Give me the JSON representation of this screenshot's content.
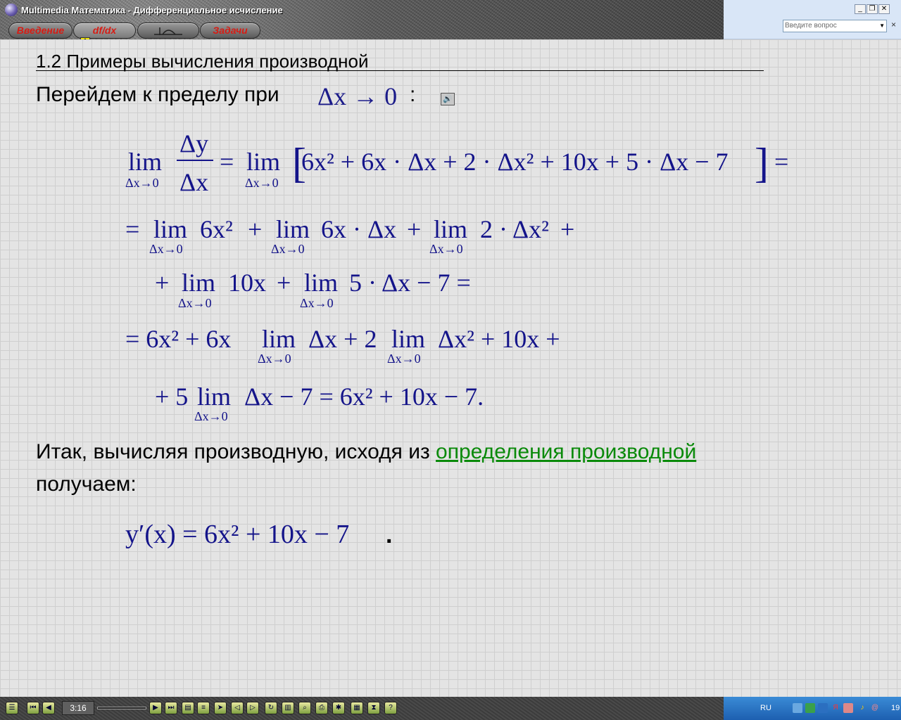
{
  "window": {
    "title": "Multimedia Математика - Дифференциальное исчисление",
    "nav": {
      "intro": "Введение",
      "deriv": "df/dx",
      "deriv_badge": "1",
      "tasks": "Задачи"
    },
    "help_placeholder": "Введите вопрос",
    "controls": {
      "minimize": "_",
      "restore": "❐",
      "close": "✕"
    },
    "help_close": "×"
  },
  "content": {
    "section_title": "1.2 Примеры вычисления производной",
    "intro_text": "Перейдем к пределу при",
    "intro_math": "Δx → 0",
    "intro_colon": ":",
    "conclusion_text_a": "Итак, вычисляя производную, исходя из",
    "conclusion_link": "определения производной",
    "conclusion_text_b": "получаем:",
    "formulas": {
      "lim": "lim",
      "sub": "Δx→0",
      "l1_num": "Δy",
      "l1_den": "Δx",
      "l1_rhs": "6x² + 6x · Δx + 2 · Δx² + 10x + 5 · Δx − 7",
      "eq": "=",
      "l2_a": "6x²",
      "l2_b": "6x · Δx",
      "l2_c": "2 · Δx²",
      "l3_a": "10x",
      "l3_b": "5 · Δx − 7 =",
      "l4_a": "= 6x² + 6x",
      "l4_b": "Δx + 2",
      "l4_c": "Δx² + 10x +",
      "l5_a": "+ 5",
      "l5_b": "Δx − 7 = 6x² + 10x − 7.",
      "result": "y′(x) = 6x² + 10x − 7",
      "result_dot": "."
    }
  },
  "player": {
    "time": "3:16"
  },
  "tray": {
    "lang": "RU",
    "clock": "19"
  }
}
